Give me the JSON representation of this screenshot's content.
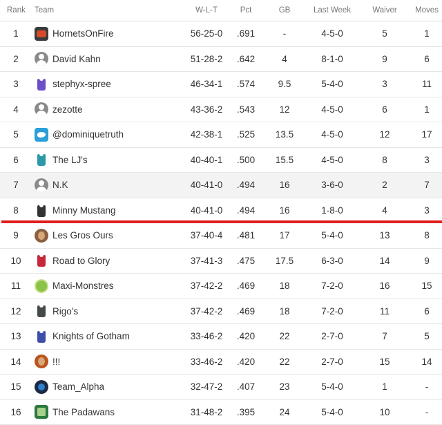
{
  "headers": {
    "rank": "Rank",
    "team": "Team",
    "wlt": "W-L-T",
    "pct": "Pct",
    "gb": "GB",
    "last_week": "Last Week",
    "waiver": "Waiver",
    "moves": "Moves"
  },
  "rows": [
    {
      "rank": "1",
      "team": "HornetsOnFire",
      "icon": "fire-logo-icon",
      "wlt": "56-25-0",
      "pct": ".691",
      "gb": "-",
      "last_week": "4-5-0",
      "waiver": "5",
      "moves": "1"
    },
    {
      "rank": "2",
      "team": "David Kahn",
      "icon": "default-avatar-icon",
      "wlt": "51-28-2",
      "pct": ".642",
      "gb": "4",
      "last_week": "8-1-0",
      "waiver": "9",
      "moves": "6"
    },
    {
      "rank": "3",
      "team": "stephyx-spree",
      "icon": "purple-jersey-icon",
      "wlt": "46-34-1",
      "pct": ".574",
      "gb": "9.5",
      "last_week": "5-4-0",
      "waiver": "3",
      "moves": "11"
    },
    {
      "rank": "4",
      "team": "zezotte",
      "icon": "default-avatar-icon",
      "wlt": "43-36-2",
      "pct": ".543",
      "gb": "12",
      "last_week": "4-5-0",
      "waiver": "6",
      "moves": "1"
    },
    {
      "rank": "5",
      "team": "@dominiquetruth",
      "icon": "twitter-bird-icon",
      "wlt": "42-38-1",
      "pct": ".525",
      "gb": "13.5",
      "last_week": "4-5-0",
      "waiver": "12",
      "moves": "17"
    },
    {
      "rank": "6",
      "team": "The LJ's",
      "icon": "teal-jersey-icon",
      "wlt": "40-40-1",
      "pct": ".500",
      "gb": "15.5",
      "last_week": "4-5-0",
      "waiver": "8",
      "moves": "3"
    },
    {
      "rank": "7",
      "team": "N.K",
      "icon": "default-avatar-icon",
      "wlt": "40-41-0",
      "pct": ".494",
      "gb": "16",
      "last_week": "3-6-0",
      "waiver": "2",
      "moves": "7"
    },
    {
      "rank": "8",
      "team": "Minny Mustang",
      "icon": "black-jersey-icon",
      "wlt": "40-41-0",
      "pct": ".494",
      "gb": "16",
      "last_week": "1-8-0",
      "waiver": "4",
      "moves": "3"
    },
    {
      "rank": "9",
      "team": "Les Gros Ours",
      "icon": "player-photo-icon",
      "wlt": "37-40-4",
      "pct": ".481",
      "gb": "17",
      "last_week": "5-4-0",
      "waiver": "13",
      "moves": "8"
    },
    {
      "rank": "10",
      "team": "Road to Glory",
      "icon": "red-jersey-icon",
      "wlt": "37-41-3",
      "pct": ".475",
      "gb": "17.5",
      "last_week": "6-3-0",
      "waiver": "14",
      "moves": "9"
    },
    {
      "rank": "11",
      "team": "Maxi-Monstres",
      "icon": "monster-logo-icon",
      "wlt": "37-42-2",
      "pct": ".469",
      "gb": "18",
      "last_week": "7-2-0",
      "waiver": "16",
      "moves": "15"
    },
    {
      "rank": "12",
      "team": "Rigo's",
      "icon": "dark-jersey-icon",
      "wlt": "37-42-2",
      "pct": ".469",
      "gb": "18",
      "last_week": "7-2-0",
      "waiver": "11",
      "moves": "6"
    },
    {
      "rank": "13",
      "team": "Knights of Gotham",
      "icon": "navy-jersey-icon",
      "wlt": "33-46-2",
      "pct": ".420",
      "gb": "22",
      "last_week": "2-7-0",
      "waiver": "7",
      "moves": "5"
    },
    {
      "rank": "14",
      "team": "!!!",
      "icon": "player-photo-icon",
      "wlt": "33-46-2",
      "pct": ".420",
      "gb": "22",
      "last_week": "2-7-0",
      "waiver": "15",
      "moves": "14"
    },
    {
      "rank": "15",
      "team": "Team_Alpha",
      "icon": "dark-circle-logo-icon",
      "wlt": "32-47-2",
      "pct": ".407",
      "gb": "23",
      "last_week": "5-4-0",
      "waiver": "1",
      "moves": "-"
    },
    {
      "rank": "16",
      "team": "The Padawans",
      "icon": "green-patch-logo-icon",
      "wlt": "31-48-2",
      "pct": ".395",
      "gb": "24",
      "last_week": "5-4-0",
      "waiver": "10",
      "moves": "-"
    }
  ],
  "colors": {
    "playoff_cutline": "#e01e1e",
    "alt_row": "#f3f3f3",
    "header_text": "#777777",
    "body_text": "#333333"
  }
}
